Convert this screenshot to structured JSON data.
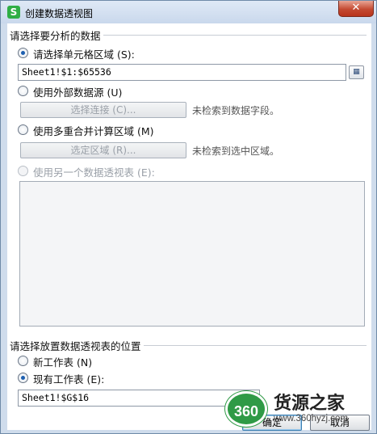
{
  "window": {
    "title": "创建数据透视图",
    "app_icon": "S",
    "close_icon": "✕"
  },
  "section1": {
    "title": "请选择要分析的数据",
    "option_range_label": "请选择单元格区域 (S):",
    "range_value": "Sheet1!$1:$65536",
    "range_button_icon": "range-select-icon",
    "option_external_label": "使用外部数据源 (U)",
    "choose_connection_label": "选择连接 (C)...",
    "no_fields_hint": "未检索到数据字段。",
    "option_multi_label": "使用多重合并计算区域 (M)",
    "select_ranges_label": "选定区域 (R)...",
    "no_ranges_hint": "未检索到选中区域。",
    "option_other_pivot_label": "使用另一个数据透视表 (E):"
  },
  "section2": {
    "title": "请选择放置数据透视表的位置",
    "option_new_sheet_label": "新工作表 (N)",
    "option_existing_sheet_label": "现有工作表 (E):",
    "location_value": "Sheet1!$G$16"
  },
  "footer": {
    "ok_label": "确定",
    "cancel_label": "取消"
  },
  "watermark": {
    "logo_text": "360",
    "title": "货源之家",
    "url": "www.360hyzj.com"
  }
}
